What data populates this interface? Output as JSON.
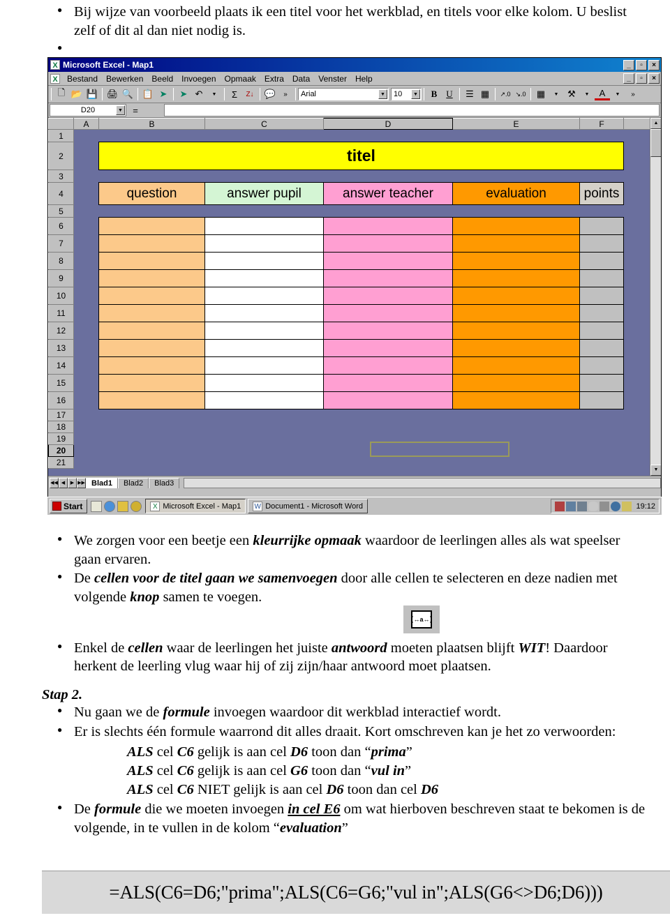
{
  "top_text": {
    "bullets": [
      "Bij wijze van voorbeeld plaats ik een titel voor het werkblad, en titels voor elke kolom. U beslist zelf of dit al dan niet nodig is.",
      ""
    ]
  },
  "excel": {
    "titlebar": {
      "title": "Microsoft Excel - Map1",
      "icon": "excel-icon",
      "minimize": "_",
      "restore": "▫",
      "close": "×"
    },
    "menubar": {
      "items": [
        "Bestand",
        "Bewerken",
        "Beeld",
        "Invoegen",
        "Opmaak",
        "Extra",
        "Data",
        "Venster",
        "Help"
      ],
      "minimize": "_",
      "restore": "▫",
      "close": "×"
    },
    "toolbar": {
      "icons": [
        "new-icon",
        "open-icon",
        "save-icon",
        "print-icon",
        "print-preview-icon",
        "paste-icon",
        "hyperlink-icon",
        "back-arrow-icon",
        "undo-icon",
        "autosum-icon",
        "sort-za-icon",
        "help-icon",
        "more-icon"
      ],
      "font_name": "Arial",
      "font_size": "10",
      "bold_label": "B",
      "underline_label": "U",
      "right_icons": [
        "align-icon",
        "merge-cells-icon",
        "increase-decimal-icon",
        "decrease-decimal-icon",
        "borders-icon",
        "fill-color-icon",
        "font-color-icon",
        "more-icon"
      ]
    },
    "formula_bar": {
      "name_box": "D20",
      "equals": "=",
      "formula_value": ""
    },
    "grid": {
      "columns": [
        "A",
        "B",
        "C",
        "D",
        "E",
        "F"
      ],
      "selected_column": "D",
      "rows": [
        "1",
        "2",
        "3",
        "4",
        "5",
        "6",
        "7",
        "8",
        "9",
        "10",
        "11",
        "12",
        "13",
        "14",
        "15",
        "16",
        "17",
        "18",
        "19",
        "20",
        "21"
      ],
      "selected_row": "20",
      "title_cell": "titel",
      "title_color": "#ffff00",
      "headers": [
        {
          "label": "question",
          "color": "#fcc98a"
        },
        {
          "label": "answer pupil",
          "color": "#d4f5d4"
        },
        {
          "label": "answer teacher",
          "color": "#ff9fd2"
        },
        {
          "label": "evaluation",
          "color": "#ff9900"
        },
        {
          "label": "points",
          "color": "#d4d0c8"
        }
      ],
      "data_row_colors": [
        "#fcc98a",
        "#ffffff",
        "#ff9fd2",
        "#ff9900",
        "#c0c0c0"
      ],
      "data_rows": [
        "6",
        "7",
        "8",
        "9",
        "10",
        "11",
        "12",
        "13",
        "14",
        "15",
        "16"
      ],
      "background_color": "#6a6f9e",
      "active_cell": "D20"
    },
    "sheet_tabs": {
      "tabs": [
        "Blad1",
        "Blad2",
        "Blad3"
      ],
      "active": "Blad1",
      "nav_first": "◀◀",
      "nav_prev": "◀",
      "nav_next": "▶",
      "nav_last": "▶▶"
    }
  },
  "taskbar": {
    "start_label": "Start",
    "quick_launch": [
      "show-desktop-icon",
      "internet-explorer-icon",
      "outlook-icon",
      "media-icon"
    ],
    "tasks": [
      {
        "label": "Microsoft Excel - Map1",
        "icon": "excel-icon",
        "active": true
      },
      {
        "label": "Document1 - Microsoft Word",
        "icon": "word-icon",
        "active": false
      }
    ],
    "tray_icons": [
      "scheduler-icon",
      "volume-icon",
      "network-icon",
      "mouse-icon",
      "printer-icon",
      "display-icon",
      "security-icon"
    ],
    "clock": "19:12"
  },
  "mid_text": {
    "b1_a": "We zorgen voor een beetje een ",
    "b1_em": "kleurrijke opmaak",
    "b1_b": " waardoor de leerlingen alles als wat speelser gaan ervaren.",
    "b2_a": "De ",
    "b2_em": "cellen voor de titel gaan we samenvoegen",
    "b2_b": " door alle cellen te selecteren en deze nadien met volgende ",
    "b2_em2": "knop",
    "b2_c": " samen te voegen.",
    "b3_a": "Enkel de ",
    "b3_em": "cellen",
    "b3_b": " waar de leerlingen het juiste ",
    "b3_em2": "antwoord",
    "b3_c": " moeten plaatsen blijft ",
    "b3_em3": "WIT",
    "b3_d": "! Daardoor herkent de leerling vlug waar hij of zij zijn/haar antwoord moet plaatsen."
  },
  "step2": {
    "label": "Stap 2.",
    "b1_a": "Nu gaan we de ",
    "b1_em": "formule",
    "b1_b": " invoegen waardoor dit werkblad interactief wordt.",
    "b2": "Er is slechts één formule waarrond dit alles draait. Kort omschreven kan je het zo verwoorden:",
    "conditions": [
      {
        "als": "ALS",
        "mid1": " cel ",
        "c1": "C6",
        "mid2": " gelijk is aan cel ",
        "c2": "D6",
        "mid3": " toon dan “",
        "res": "prima",
        "end": "”"
      },
      {
        "als": "ALS",
        "mid1": " cel ",
        "c1": "C6",
        "mid2": " gelijk is aan cel ",
        "c2": "G6",
        "mid3": " toon dan “",
        "res": "vul in",
        "end": "”"
      },
      {
        "als": "ALS",
        "mid1": " cel ",
        "c1": "C6",
        "mid2": " NIET gelijk is aan cel ",
        "c2": "D6",
        "mid3": " toon dan cel ",
        "res": "D6",
        "end": ""
      }
    ],
    "b3_a": "De ",
    "b3_em": "formule",
    "b3_b": " die we moeten invoegen ",
    "b3_u": "in cel E6",
    "b3_c": " om wat hierboven beschreven staat te bekomen is de volgende, in te vullen in de kolom “",
    "b3_em2": "evaluation",
    "b3_d": "”"
  },
  "formula_box": {
    "formula": "=ALS(C6=D6;\"prima\";ALS(C6=G6;\"vul in\";ALS(G6<>D6;D6)))"
  }
}
